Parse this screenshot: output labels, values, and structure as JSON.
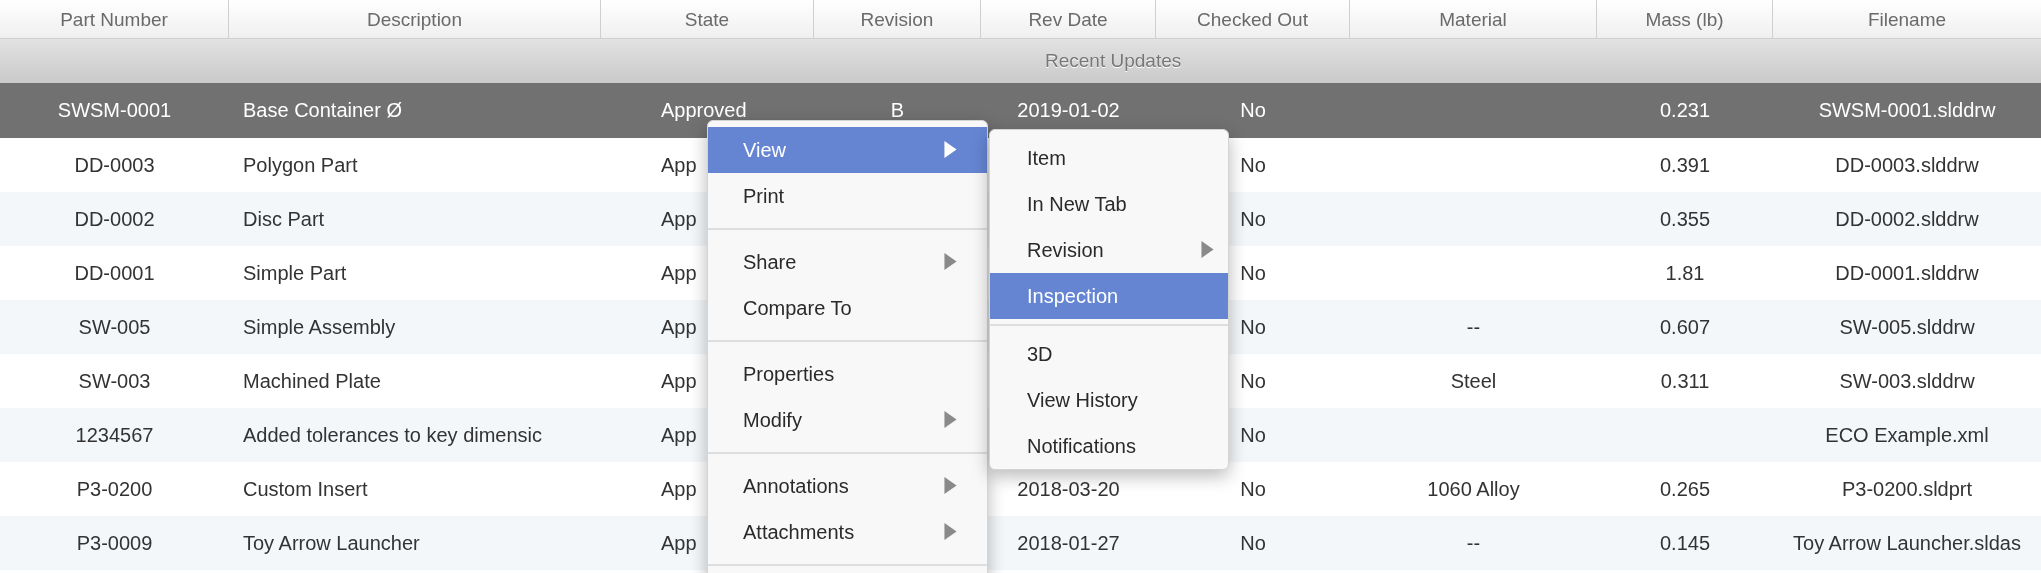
{
  "table": {
    "columns": [
      "Part Number",
      "Description",
      "State",
      "Revision",
      "Rev Date",
      "Checked Out",
      "Material",
      "Mass (lb)",
      "Filename"
    ],
    "group": {
      "label": "Recent Updates"
    },
    "rows": [
      {
        "selected": true,
        "cells": [
          "SWSM-0001",
          "Base Container Ø",
          "Approved",
          "B",
          "2019-01-02",
          "No",
          null,
          "0.231",
          "SWSM-0001.slddrw"
        ]
      },
      {
        "selected": false,
        "cells": [
          "DD-0003",
          "Polygon Part",
          "App",
          null,
          null,
          "No",
          null,
          "0.391",
          "DD-0003.slddrw"
        ]
      },
      {
        "selected": false,
        "cells": [
          "DD-0002",
          "Disc Part",
          "App",
          null,
          null,
          "No",
          null,
          "0.355",
          "DD-0002.slddrw"
        ]
      },
      {
        "selected": false,
        "cells": [
          "DD-0001",
          "Simple Part",
          "App",
          null,
          null,
          "No",
          null,
          "1.81",
          "DD-0001.slddrw"
        ]
      },
      {
        "selected": false,
        "cells": [
          "SW-005",
          "Simple Assembly",
          "App",
          null,
          null,
          "No",
          "--",
          "0.607",
          "SW-005.slddrw"
        ]
      },
      {
        "selected": false,
        "cells": [
          "SW-003",
          "Machined Plate",
          "App",
          null,
          null,
          "No",
          "Steel",
          "0.311",
          "SW-003.slddrw"
        ]
      },
      {
        "selected": false,
        "cells": [
          "1234567",
          "Added tolerances to key dimensic",
          "App",
          null,
          null,
          "No",
          null,
          null,
          "ECO Example.xml"
        ]
      },
      {
        "selected": false,
        "cells": [
          "P3-0200",
          "Custom Insert",
          "App",
          null,
          "2018-03-20",
          "No",
          "1060 Alloy",
          "0.265",
          "P3-0200.sldprt"
        ]
      },
      {
        "selected": false,
        "cells": [
          "P3-0009",
          "Toy Arrow Launcher",
          "App",
          null,
          "2018-01-27",
          "No",
          "--",
          "0.145",
          "Toy Arrow Launcher.sldas"
        ]
      }
    ]
  },
  "context_menu": {
    "groups": [
      [
        {
          "label": "View",
          "selected": true,
          "submenu": true
        },
        {
          "label": "Print",
          "selected": false,
          "submenu": false
        }
      ],
      [
        {
          "label": "Share",
          "selected": false,
          "submenu": true
        },
        {
          "label": "Compare To",
          "selected": false,
          "submenu": false
        }
      ],
      [
        {
          "label": "Properties",
          "selected": false,
          "submenu": false
        },
        {
          "label": "Modify",
          "selected": false,
          "submenu": true
        }
      ],
      [
        {
          "label": "Annotations",
          "selected": false,
          "submenu": true
        },
        {
          "label": "Attachments",
          "selected": false,
          "submenu": true
        }
      ]
    ]
  },
  "submenu": {
    "groups": [
      [
        {
          "label": "Item",
          "selected": false,
          "submenu": false
        },
        {
          "label": "In New Tab",
          "selected": false,
          "submenu": false
        },
        {
          "label": "Revision",
          "selected": false,
          "submenu": true
        },
        {
          "label": "Inspection",
          "selected": true,
          "submenu": false
        }
      ],
      [
        {
          "label": "3D",
          "selected": false,
          "submenu": false
        },
        {
          "label": "View History",
          "selected": false,
          "submenu": false
        },
        {
          "label": "Notifications",
          "selected": false,
          "submenu": false
        }
      ]
    ]
  }
}
